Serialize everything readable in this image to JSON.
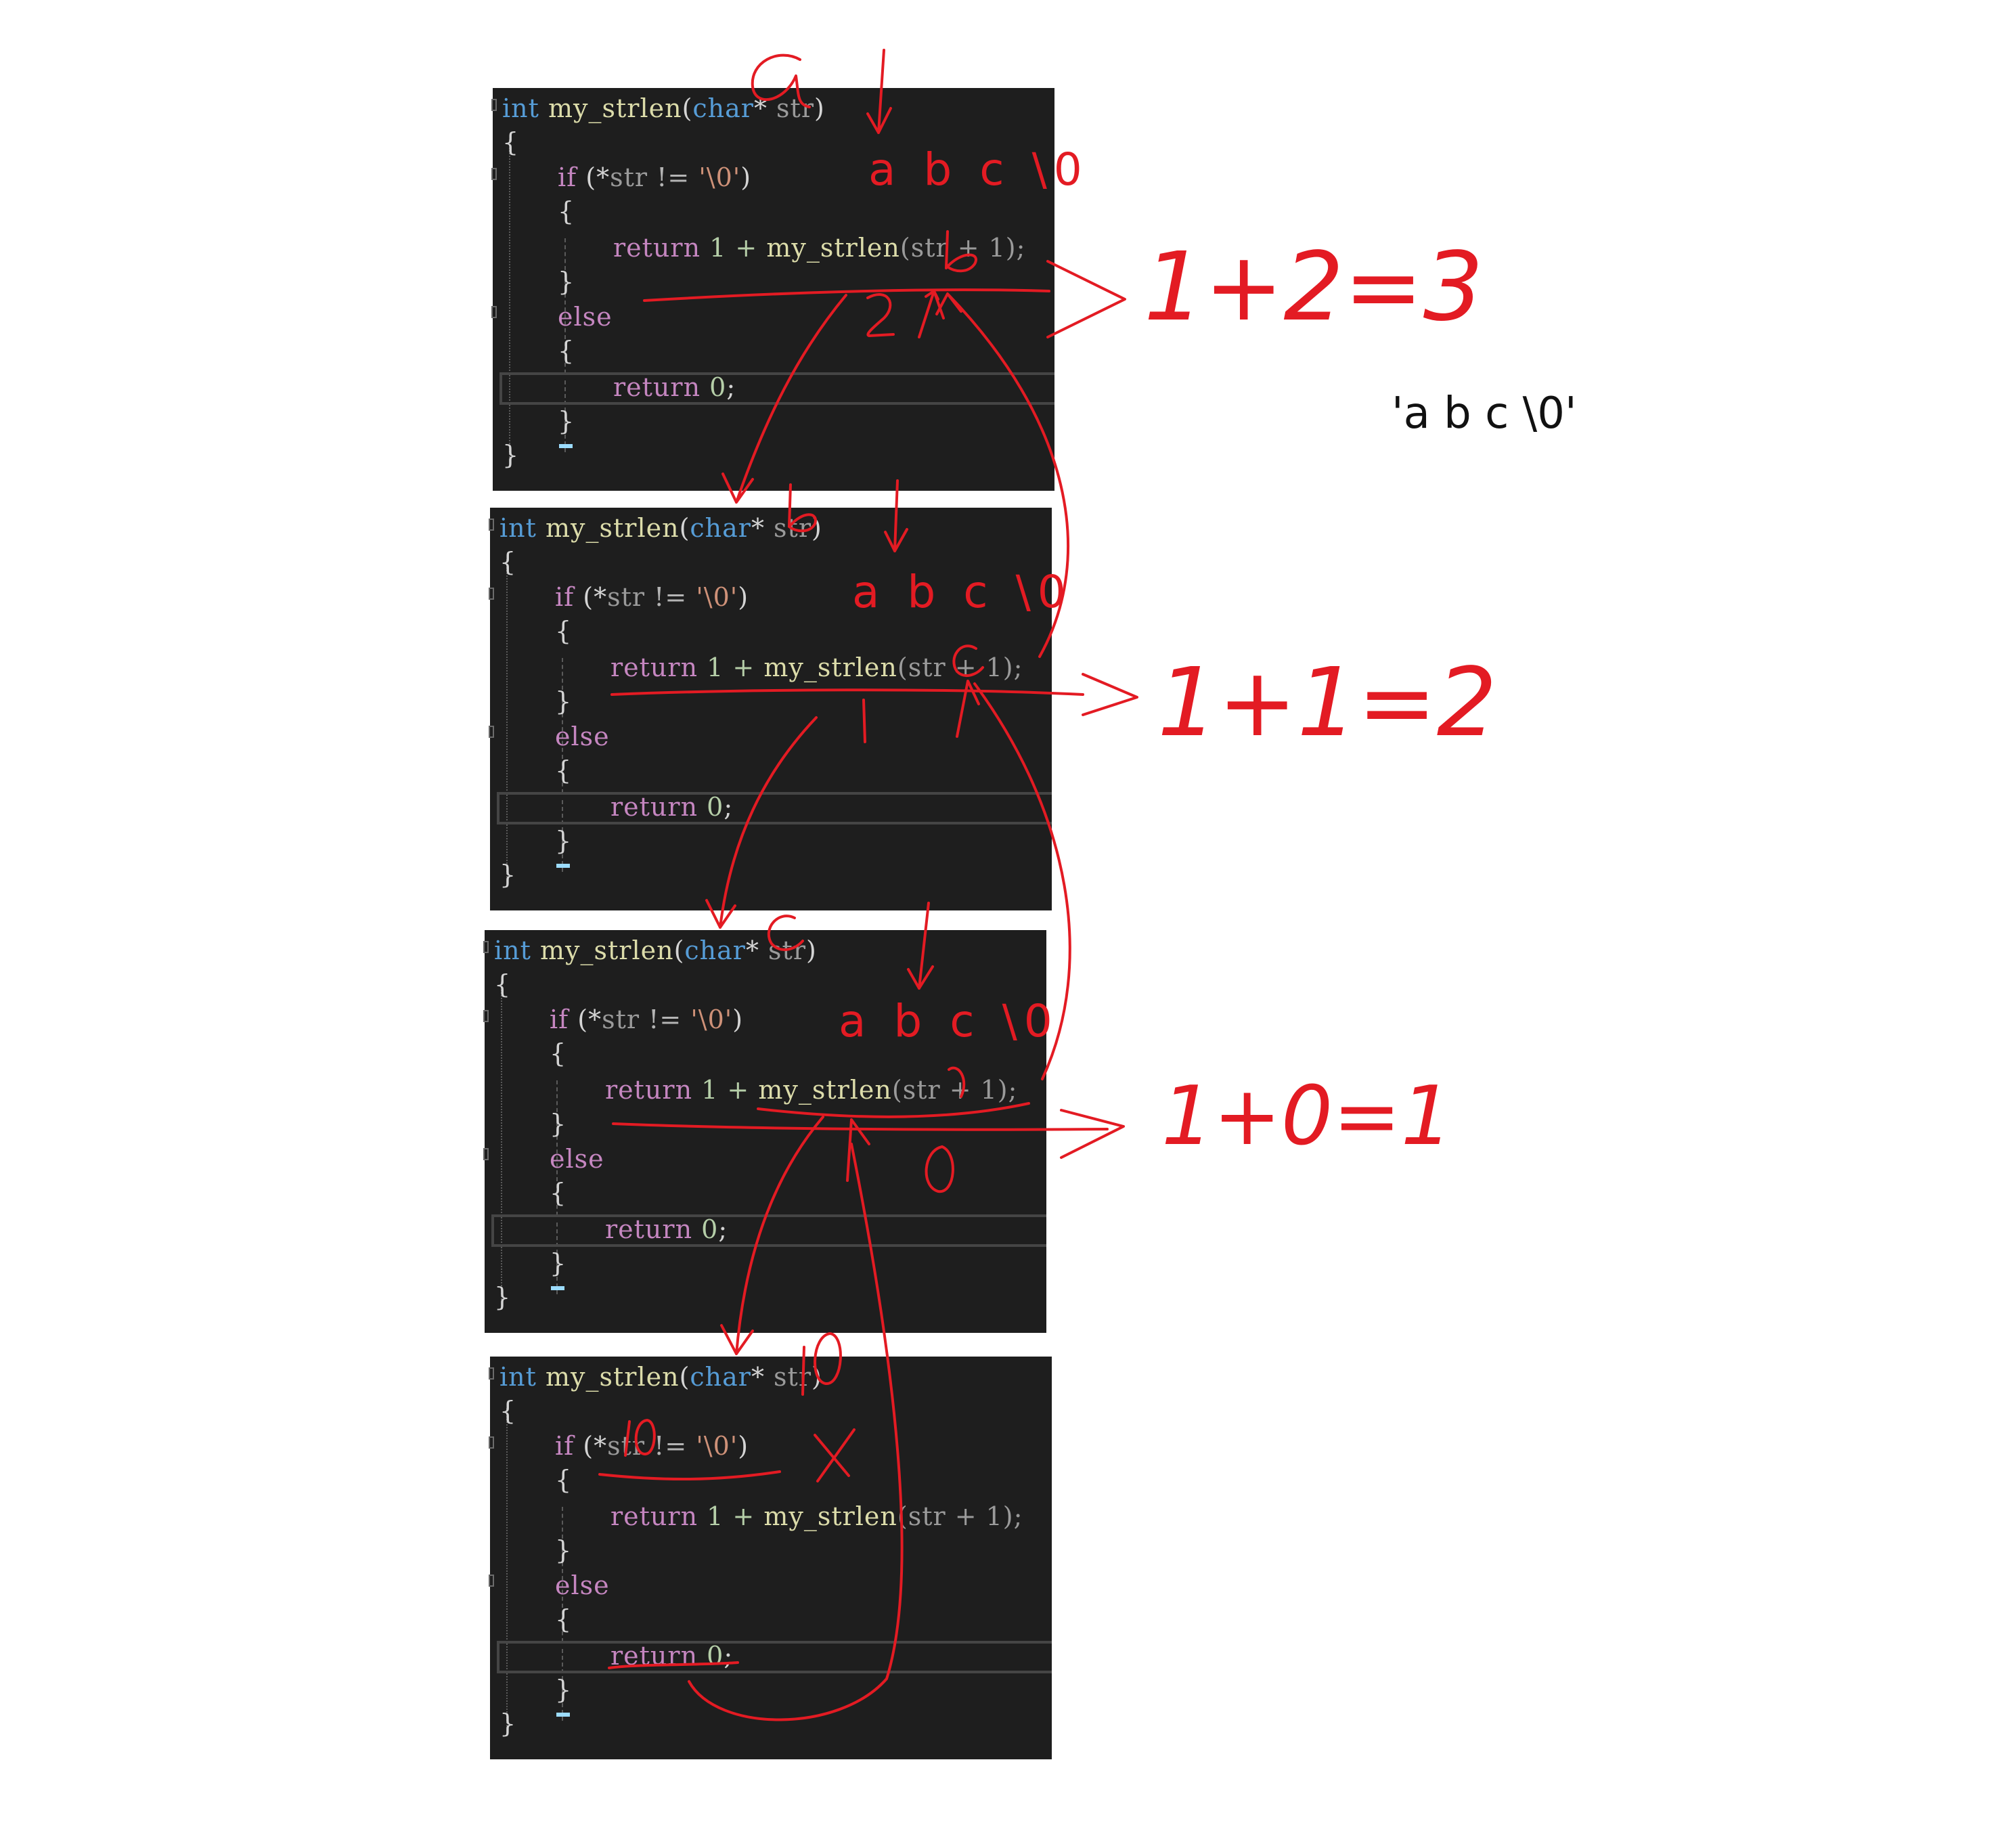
{
  "code": {
    "lines": [
      {
        "kind": "header",
        "type_kw": "int",
        "fn_name": "my_strlen",
        "open": "(",
        "param_type": "char",
        "star": "*",
        "param": " str",
        "close": ")"
      },
      {
        "kind": "brace",
        "text": "{"
      },
      {
        "kind": "if",
        "keyword": "if",
        "cond_open": " (*",
        "cond_var": "str",
        "cond_op": " != ",
        "cond_lit": "'\\0'",
        "cond_close": ")"
      },
      {
        "kind": "brace",
        "text": "{"
      },
      {
        "kind": "return-call",
        "keyword": "return",
        "expr_a": " 1 + ",
        "callee": "my_strlen",
        "args": "(str + 1);"
      },
      {
        "kind": "brace",
        "text": "}"
      },
      {
        "kind": "else",
        "keyword": "else"
      },
      {
        "kind": "brace",
        "text": "{"
      },
      {
        "kind": "return-zero",
        "keyword": "return",
        "value": " 0",
        "semi": ";"
      },
      {
        "kind": "brace",
        "text": "}"
      },
      {
        "kind": "brace",
        "text": "}"
      }
    ]
  },
  "annotations": {
    "string_notes": [
      "a b c \\0",
      "a b c \\0",
      "a b c \\0"
    ],
    "char_marks": [
      "a",
      "b",
      "c",
      "\\0"
    ],
    "results": [
      "1+2=3",
      "1+1=2",
      "1+0=1"
    ],
    "returned_values": [
      "2",
      "1",
      "0"
    ],
    "false_mark": "X",
    "side_label": "'a b c \\0'"
  },
  "colors": {
    "editor_bg": "#1e1e1e",
    "keyword_type": "#569cd6",
    "keyword_control": "#c586c0",
    "function": "#dcdcaa",
    "ink": "#e31b23"
  }
}
